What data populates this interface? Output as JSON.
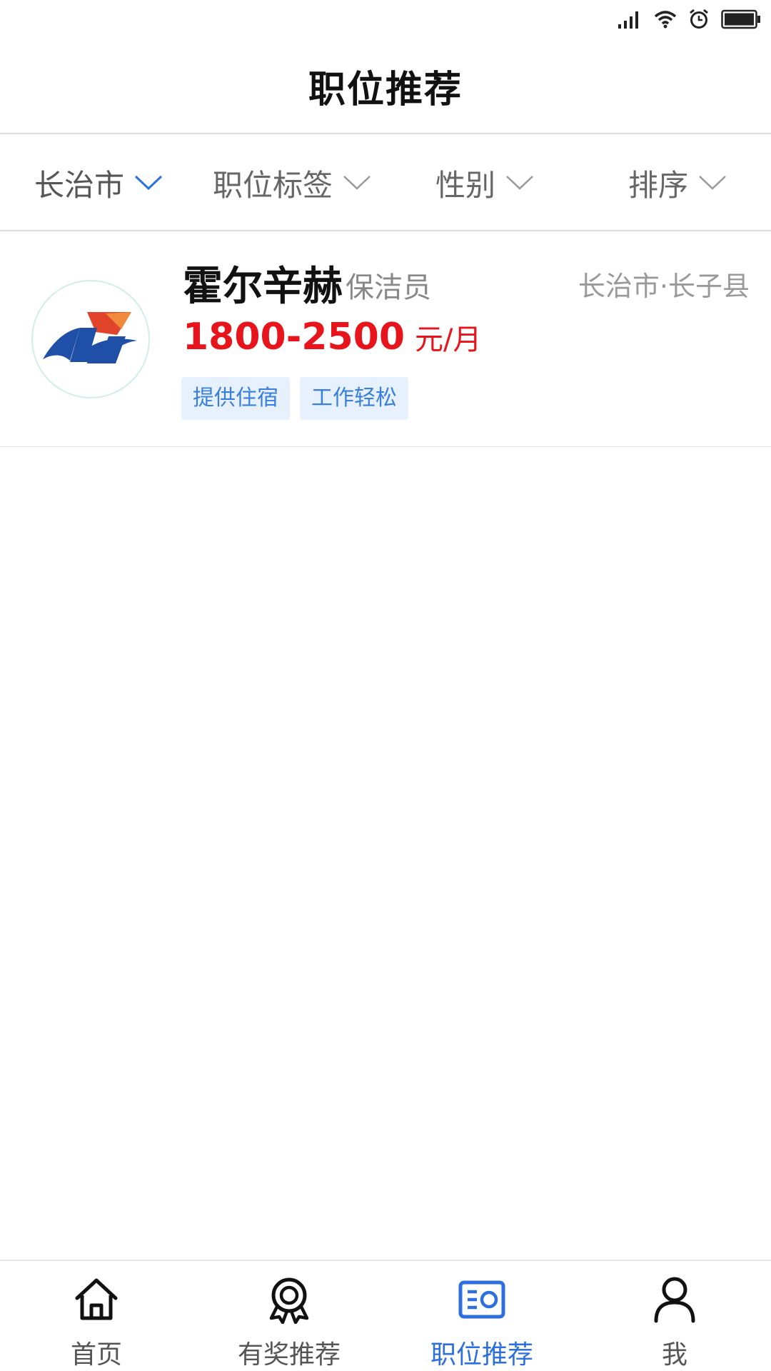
{
  "page": {
    "title": "职位推荐"
  },
  "status_bar": {
    "icons": [
      "signal-icon",
      "wifi-icon",
      "alarm-icon",
      "battery-icon"
    ]
  },
  "filters": [
    {
      "label": "长治市",
      "active": true
    },
    {
      "label": "职位标签",
      "active": false
    },
    {
      "label": "性别",
      "active": false
    },
    {
      "label": "排序",
      "active": false
    }
  ],
  "jobs": [
    {
      "company": "霍尔辛赫",
      "position": "保洁员",
      "location": "长治市·长子县",
      "salary": "1800-2500",
      "salary_unit": "元/月",
      "tags": [
        "提供住宿",
        "工作轻松"
      ]
    }
  ],
  "nav": [
    {
      "label": "首页",
      "icon": "home-icon"
    },
    {
      "label": "有奖推荐",
      "icon": "award-icon"
    },
    {
      "label": "职位推荐",
      "icon": "job-card-icon",
      "active": true
    },
    {
      "label": "我",
      "icon": "person-icon"
    }
  ],
  "colors": {
    "accent": "#2e6fe0",
    "salary": "#e8141c",
    "tag_bg": "#e7f1fd",
    "tag_text": "#3a7fdd"
  }
}
